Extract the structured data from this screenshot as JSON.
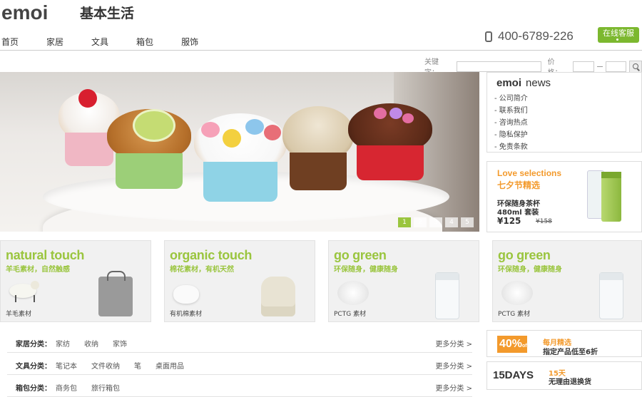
{
  "header": {
    "logo": "emoi",
    "logo_cn": "基本生活",
    "phone": "400-6789-226",
    "online_service": "在线客服"
  },
  "nav": [
    "首页",
    "家居",
    "文具",
    "箱包",
    "服饰"
  ],
  "search": {
    "keyword_label": "关键字：",
    "price_label": "价格："
  },
  "hero": {
    "slides": [
      "1",
      "2",
      "3",
      "4",
      "5"
    ],
    "active_slide": "1"
  },
  "news": {
    "title_brand": "emoi",
    "title_word": "news",
    "items": [
      "- 公司简介",
      "- 联系我们",
      "- 咨询热点",
      "- 隐私保护",
      "- 免责条款"
    ]
  },
  "love": {
    "title_en": "Love selections",
    "title_cn": "七夕节精选",
    "product_line1": "环保随身茶杯",
    "product_line2": "480ml 套装",
    "price": "¥125",
    "old_price": "¥158"
  },
  "cards": [
    {
      "title": "natural touch",
      "subtitle": "羊毛素材，自然触感",
      "label": "羊毛素材"
    },
    {
      "title": "organic touch",
      "subtitle": "棉花素材，有机天然",
      "label": "有机棉素材"
    },
    {
      "title": "go green",
      "subtitle": "环保随身，健康随身",
      "label": "PCTG 素材"
    },
    {
      "title": "go green",
      "subtitle": "环保随身，健康随身",
      "label": "PCTG 素材"
    }
  ],
  "categories": [
    {
      "label": "家居分类：",
      "items": [
        "家纺",
        "收纳",
        "家饰"
      ],
      "more": "更多分类 >"
    },
    {
      "label": "文具分类：",
      "items": [
        "笔记本",
        "文件收纳",
        "笔",
        "桌面用品"
      ],
      "more": "更多分类 >"
    },
    {
      "label": "箱包分类：",
      "items": [
        "商务包",
        "旅行箱包"
      ],
      "more": "更多分类 >"
    }
  ],
  "promos": {
    "discount_badge": "40%",
    "discount_off": "off",
    "monthly_title": "每月精选",
    "monthly_text": "指定产品低至6折",
    "days_badge": "15DAYS",
    "days_title": "15天",
    "days_text": "无理由退换货"
  },
  "colors": {
    "accent_green": "#9ac53e",
    "accent_orange": "#f39a2c"
  }
}
